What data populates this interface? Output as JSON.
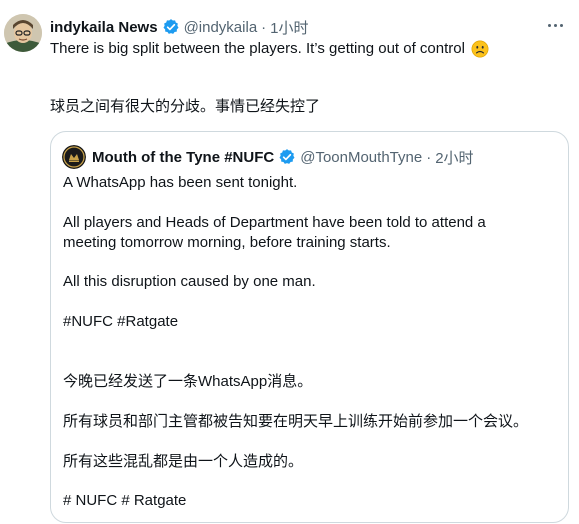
{
  "tweet": {
    "author_name": "indykaila News",
    "author_handle": "@indykaila",
    "separator": "·",
    "time": "1小时",
    "text_en": "There is big split between the players. It’s getting out of control",
    "text_zh": "球员之间有很大的分歧。事情已经失控了",
    "emoji": "slightly-frowning-face-emoji"
  },
  "quote": {
    "author_name": "Mouth of the Tyne #NUFC",
    "author_handle": "@ToonMouthTyne",
    "separator": "·",
    "time": "2小时",
    "lines": [
      "A WhatsApp has been sent tonight.",
      "All players and Heads of Department have been told to attend a",
      "meeting tomorrow morning, before training starts.",
      "All this disruption caused by one man.",
      "#NUFC #Ratgate",
      "今晚已经发送了一条WhatsApp消息。",
      "所有球员和部门主管都被告知要在明天早上训练开始前参加一个会议。",
      "所有这些混乱都是由一个人造成的。",
      "# NUFC # Ratgate"
    ]
  },
  "icons": {
    "verified": "verified-badge-icon",
    "more": "more-options-icon"
  },
  "colors": {
    "text": "#0f1419",
    "secondary": "#536471",
    "verified": "#1d9bf0",
    "border": "#cfd9de"
  }
}
